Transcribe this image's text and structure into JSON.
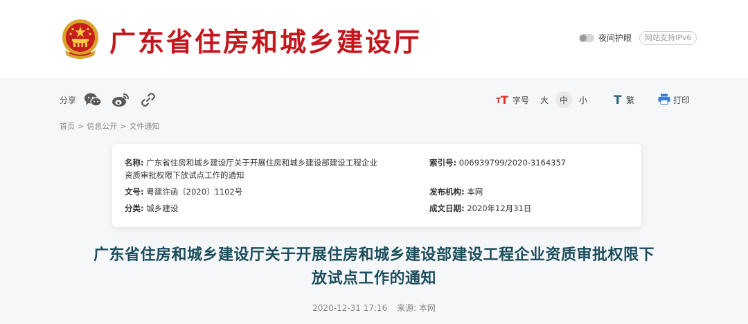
{
  "header": {
    "site_title": "广东省住房和城乡建设厅",
    "night_mode_label": "夜间护眼",
    "ipv6_label": "网站支持IPv6"
  },
  "share": {
    "label": "分享",
    "icons": [
      "wechat-icon",
      "weibo-icon",
      "link-icon"
    ]
  },
  "tools": {
    "font_size_label": "字号",
    "size_large": "大",
    "size_medium": "中",
    "size_small": "小",
    "traditional_label": "繁",
    "print_label": "打印"
  },
  "breadcrumb": {
    "items": [
      "首页",
      "信息公开",
      "文件通知"
    ],
    "separator": ">"
  },
  "info": {
    "name_label": "名称:",
    "name_value_line1": "广东省住房和城乡建设厅关于开展住房和城乡建设部建设工程企业",
    "name_value_line2": "资质审批权限下放试点工作的通知",
    "index_label": "索引号:",
    "index_value": "006939799/2020-3164357",
    "docno_label": "文号:",
    "docno_value": "粤建许函〔2020〕1102号",
    "publisher_label": "发布机构:",
    "publisher_value": "本网",
    "category_label": "分类:",
    "category_value": "城乡建设",
    "date_label": "成文日期:",
    "date_value": "2020年12月31日"
  },
  "article": {
    "title_line1": "广东省住房和城乡建设厅关于开展住房和城乡建设部建设工程企业资质审批权限下",
    "title_line2": "放试点工作的通知",
    "datetime": "2020-12-31 17:16",
    "source_label": "来源:",
    "source_value": "本网"
  },
  "colors": {
    "brand_red": "#c2171d",
    "title_teal": "#1c4d5c",
    "tool_red": "#d9342b",
    "tool_teal": "#2a6a78",
    "print_blue": "#3b7fd6"
  }
}
